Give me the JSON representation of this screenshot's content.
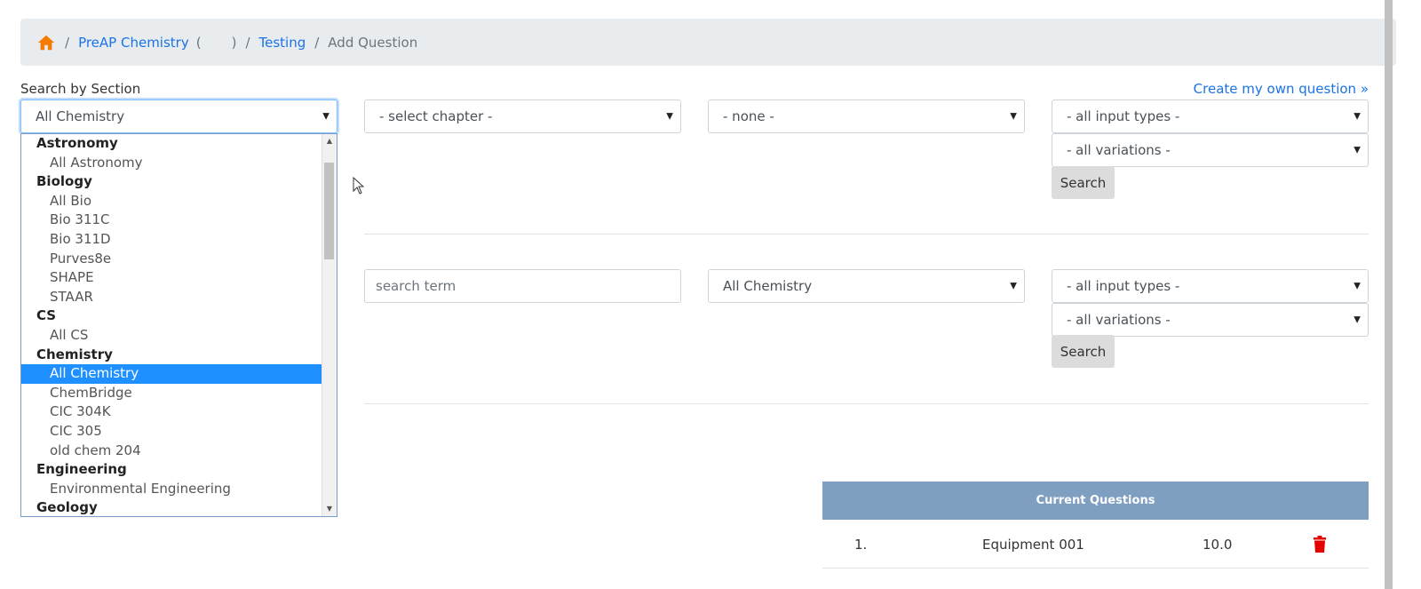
{
  "breadcrumb": {
    "home_icon": "home-icon",
    "items": [
      "PreAP Chemistry",
      "(",
      ")",
      "Testing",
      "Add Question"
    ],
    "separator": "/"
  },
  "search_by_section": {
    "label": "Search by Section",
    "create_link": "Create my own question »",
    "section_value": "All Chemistry",
    "chapter_value": "- select chapter -",
    "subchapter_value": "- none -",
    "input_types_value": "- all input types -",
    "variations_value": "- all variations -",
    "search_label": "Search"
  },
  "search_by_term": {
    "placeholder": "search term",
    "section_value": "All Chemistry",
    "input_types_value": "- all input types -",
    "variations_value": "- all variations -",
    "search_label": "Search"
  },
  "dropdown": {
    "items": [
      {
        "text": "Astronomy",
        "kind": "group"
      },
      {
        "text": "All Astronomy",
        "kind": "option"
      },
      {
        "text": "Biology",
        "kind": "group"
      },
      {
        "text": "All Bio",
        "kind": "option"
      },
      {
        "text": "Bio 311C",
        "kind": "option"
      },
      {
        "text": "Bio 311D",
        "kind": "option"
      },
      {
        "text": "Purves8e",
        "kind": "option"
      },
      {
        "text": "SHAPE",
        "kind": "option"
      },
      {
        "text": "STAAR",
        "kind": "option"
      },
      {
        "text": "CS",
        "kind": "group"
      },
      {
        "text": "All CS",
        "kind": "option"
      },
      {
        "text": "Chemistry",
        "kind": "group"
      },
      {
        "text": "All Chemistry",
        "kind": "option",
        "selected": true
      },
      {
        "text": "ChemBridge",
        "kind": "option"
      },
      {
        "text": "CIC 304K",
        "kind": "option"
      },
      {
        "text": "CIC 305",
        "kind": "option"
      },
      {
        "text": "old chem 204",
        "kind": "option"
      },
      {
        "text": "Engineering",
        "kind": "group"
      },
      {
        "text": "Environmental Engineering",
        "kind": "option"
      },
      {
        "text": "Geology",
        "kind": "group"
      }
    ]
  },
  "current_questions": {
    "header": "Current Questions",
    "rows": [
      {
        "index": "1.",
        "name": "Equipment 001",
        "points": "10.0",
        "delete_icon": "trash-icon"
      }
    ]
  },
  "colors": {
    "link": "#1a73e8",
    "home_icon": "#f57c00",
    "selected_option": "#1e90ff",
    "table_header": "#7f9fc1",
    "delete_icon": "#e60000"
  }
}
